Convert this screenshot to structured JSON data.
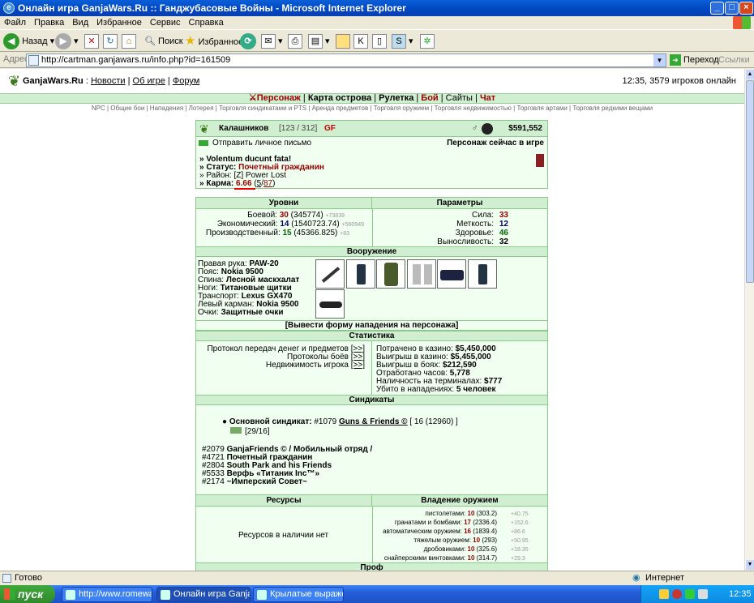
{
  "window": {
    "title": "Онлайн игра GanjaWars.Ru :: Ганджубасовые Войны - Microsoft Internet Explorer"
  },
  "menu": [
    "Файл",
    "Правка",
    "Вид",
    "Избранное",
    "Сервис",
    "Справка"
  ],
  "toolbar": {
    "back": "Назад",
    "search": "Поиск",
    "favorites": "Избранное"
  },
  "address": {
    "label": "Адрес:",
    "url": "http://cartman.ganjawars.ru/info.php?id=161509",
    "go": "Переход",
    "links": "Ссылки"
  },
  "site": {
    "brand": "GanjaWars.Ru",
    "sep": ":",
    "news": "Новости",
    "about": "Об игре",
    "forum": "Форум",
    "online": "12:35, 3579 игроков онлайн"
  },
  "nav": [
    "Персонаж",
    "Карта острова",
    "Рулетка",
    "Бой",
    "Сайты",
    "Чат"
  ],
  "subnav": "NPC | Общие бои | Нападения | Лотерея | Торговля синдикатами и PTS | Аренда предметов | Торговля оружием | Торговля недвижимостью | Торговля артами | Торговля редкими вещами",
  "player": {
    "name": "Калашников",
    "level": "[123 / 312]",
    "money": "$591,552",
    "send_msg": "Отправить личное письмо",
    "in_game": "Персонаж сейчас в игре",
    "motto": "» Volentum ducunt fata!",
    "status_label": "» Статус:",
    "status": "Почетный гражданин",
    "district_label": "» Район:",
    "district": "[Z] Power Lost",
    "karma_label": "» Карма:",
    "karma": "6.66",
    "karma_pos": "5",
    "karma_neg": "87"
  },
  "levels": {
    "title": "Уровни",
    "combat_label": "Боевой:",
    "combat": "30",
    "combat_exp": "(345774)",
    "combat_plus": "+73839",
    "econ_label": "Экономический:",
    "econ": "14",
    "econ_exp": "(1540723.74)",
    "econ_plus": "+560949",
    "prod_label": "Производственный:",
    "prod": "15",
    "prod_exp": "(45366.825)",
    "prod_plus": "+83"
  },
  "params": {
    "title": "Параметры",
    "str_label": "Сила:",
    "str": "33",
    "acc_label": "Меткость:",
    "acc": "12",
    "hp_label": "Здоровье:",
    "hp": "46",
    "end_label": "Выносливость:",
    "end": "32"
  },
  "equip": {
    "title": "Вооружение",
    "lines": [
      {
        "label": "Правая рука:",
        "value": "PAW-20"
      },
      {
        "label": "Пояс:",
        "value": "Nokia 9500"
      },
      {
        "label": "Спина:",
        "value": "Лесной маскхалат"
      },
      {
        "label": "Ноги:",
        "value": "Титановые щитки"
      },
      {
        "label": "Транспорт:",
        "value": "Lexus GX470"
      },
      {
        "label": "Левый карман:",
        "value": "Nokia 9500"
      },
      {
        "label": "Очки:",
        "value": "Защитные очки"
      }
    ]
  },
  "attack_form": "[Вывести форму нападения на персонажа]",
  "stats": {
    "title": "Статистика",
    "links": [
      {
        "label": "Протокол передач денег и предметов",
        "btn": "[>>]"
      },
      {
        "label": "Протоколы боёв",
        "btn": "[>>]"
      },
      {
        "label": "Недвижимость игрока",
        "btn": "[>>]"
      }
    ],
    "values": [
      {
        "label": "Потрачено в казино:",
        "value": "$5,450,000"
      },
      {
        "label": "Выигрыш в казино:",
        "value": "$5,455,000"
      },
      {
        "label": "Выигрыш в боях:",
        "value": "$212,590"
      },
      {
        "label": "Отработано часов:",
        "value": "5,778"
      },
      {
        "label": "Наличность на терминалах:",
        "value": "$777"
      },
      {
        "label": "Убито в нападениях:",
        "value": "5 человек"
      }
    ]
  },
  "syndicates": {
    "title": "Синдикаты",
    "main_label": "Основной синдикат:",
    "main_id": "#1079",
    "main_name": "Guns & Friends ©",
    "main_level": "[ 16 (12960) ]",
    "main_sub": "[29/16]",
    "list": [
      {
        "id": "#2079",
        "name": "GanjaFriends © / Мобильный отряд /"
      },
      {
        "id": "#4721",
        "name": "Почетный гражданин"
      },
      {
        "id": "#2804",
        "name": "South Park and his Friends"
      },
      {
        "id": "#5533",
        "name": "Верфь «Титаник Inc™»"
      },
      {
        "id": "#2174",
        "name": "~Имперский Совет~"
      }
    ]
  },
  "resources": {
    "title": "Ресурсы",
    "empty": "Ресурсов в наличии нет"
  },
  "weapons": {
    "title": "Владение оружием",
    "rows": [
      {
        "label": "пистолетами:",
        "lvl": "10",
        "exp": "(303.2)",
        "plus": "+40.75"
      },
      {
        "label": "гранатами и бомбами:",
        "lvl": "17",
        "exp": "(2336.4)",
        "plus": "+152.6"
      },
      {
        "label": "автоматическим оружием:",
        "lvl": "16",
        "exp": "(1839.4)",
        "plus": "+86.6"
      },
      {
        "label": "тяжелым оружием:",
        "lvl": "10",
        "exp": "(293)",
        "plus": "+50.95"
      },
      {
        "label": "дробовиками:",
        "lvl": "10",
        "exp": "(325.6)",
        "plus": "+18.35"
      },
      {
        "label": "снайперскими винтовками:",
        "lvl": "10",
        "exp": "(314.7)",
        "plus": "+29.3"
      }
    ]
  },
  "bottom_partial": "Проф",
  "status": {
    "left": "Готово",
    "zone": "Интернет"
  },
  "taskbar": {
    "start": "пуск",
    "tasks": [
      "http://www.romewar...",
      "Онлайн игра Ganja...",
      "Крылатые выражен..."
    ],
    "lang": "RU",
    "clock": "12:35"
  }
}
